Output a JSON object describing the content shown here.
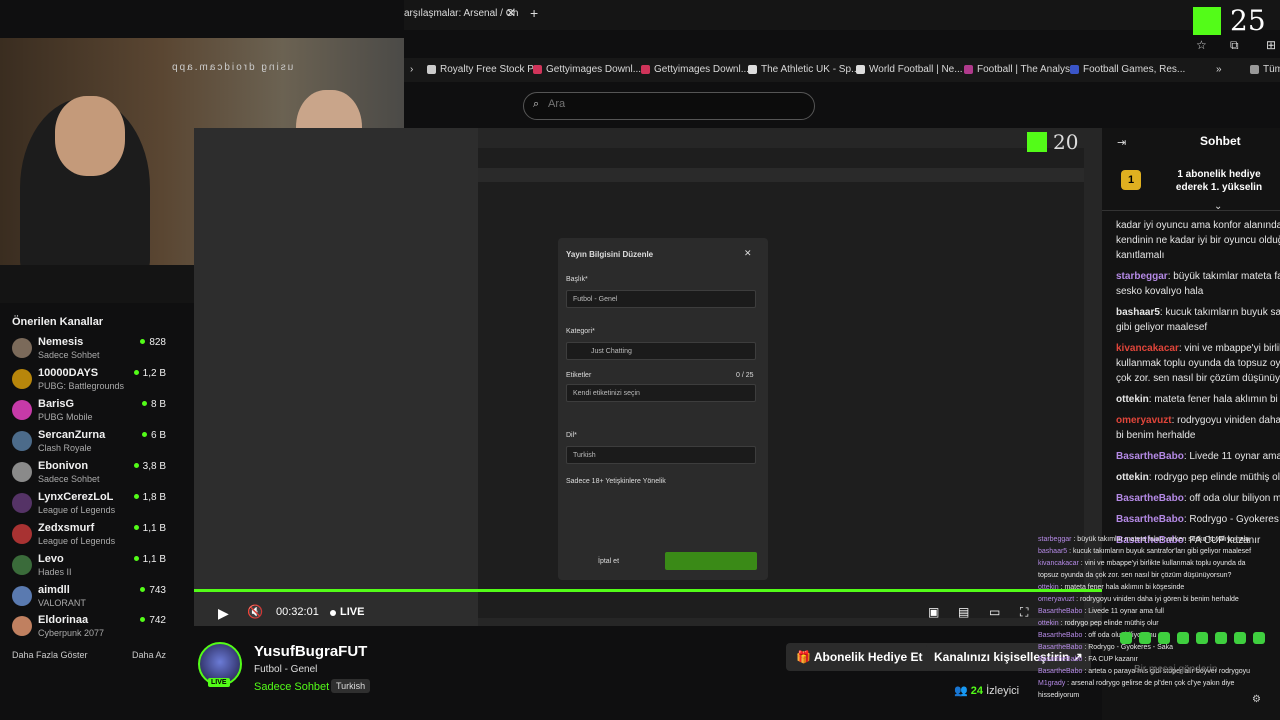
{
  "browser": {
    "tab_title": "arşılaşmalar: Arsenal / Ch",
    "tab_close": "✕",
    "new_tab": "+",
    "bookmarks": [
      {
        "label": "Royalty Free Stock P...",
        "color": "#cccccc"
      },
      {
        "label": "Gettyimages Downl...",
        "color": "#d0345a"
      },
      {
        "label": "Gettyimages Downl...",
        "color": "#d0345a"
      },
      {
        "label": "The Athletic UK - Sp...",
        "color": "#dddddd"
      },
      {
        "label": "World Football | Ne...",
        "color": "#dddddd"
      },
      {
        "label": "Football | The Analyst",
        "color": "#b03a8c"
      },
      {
        "label": "Football Games, Res...",
        "color": "#3a55c8"
      },
      {
        "label": "Tüm",
        "color": "#cccccc"
      }
    ],
    "kick_logo_text": "25"
  },
  "search": {
    "placeholder": "Ara"
  },
  "stream_inner": {
    "logo_text": "20",
    "modal_title": "Yayın Bilgisini Düzenle",
    "title_label": "Başlık*",
    "title_value": "Futbol - Genel",
    "category_label": "Kategori*",
    "category_value": "Just Chatting",
    "tags_label": "Etiketler",
    "tags_count": "0 / 25",
    "tags_placeholder": "Kendi etiketinizi seçin",
    "lang_label": "Dil*",
    "lang_value": "Turkish",
    "adult_label": "Sadece 18+ Yetişkinlere Yönelik",
    "cancel_label": "İptal et"
  },
  "player": {
    "time": "00:32:01",
    "live_label": "LIVE",
    "progress": 1.0
  },
  "sidebar": {
    "title": "Önerilen Kanallar",
    "channels": [
      {
        "name": "Nemesis",
        "game": "Sadece Sohbet",
        "viewers": "828",
        "avatar": "#7b6a5a"
      },
      {
        "name": "10000DAYS",
        "game": "PUBG: Battlegrounds",
        "viewers": "1,2 B",
        "avatar": "#b8860b"
      },
      {
        "name": "BarisG",
        "game": "PUBG Mobile",
        "viewers": "8 B",
        "avatar": "#c63aa8"
      },
      {
        "name": "SercanZurna",
        "game": "Clash Royale",
        "viewers": "6 B",
        "avatar": "#4c6b8a"
      },
      {
        "name": "Ebonivon",
        "game": "Sadece Sohbet",
        "viewers": "3,8 B",
        "avatar": "#8a8a8a"
      },
      {
        "name": "LynxCerezLoL",
        "game": "League of Legends",
        "viewers": "1,8 B",
        "avatar": "#553366"
      },
      {
        "name": "Zedxsmurf",
        "game": "League of Legends",
        "viewers": "1,1 B",
        "avatar": "#a83232"
      },
      {
        "name": "Levo",
        "game": "Hades II",
        "viewers": "1,1 B",
        "avatar": "#3a6b3a"
      },
      {
        "name": "aimdll",
        "game": "VALORANT",
        "viewers": "743",
        "avatar": "#5a7ab0"
      },
      {
        "name": "Eldorinaa",
        "game": "Cyberpunk 2077",
        "viewers": "742",
        "avatar": "#c08060"
      }
    ],
    "show_more": "Daha Fazla Göster",
    "show_less": "Daha Az"
  },
  "streamer": {
    "name": "YusufBugraFUT",
    "title": "Futbol - Genel",
    "category": "Sadece Sohbet",
    "tag": "Turkish",
    "live_badge": "LIVE",
    "gift_button": "Abonelik Hediye Et",
    "customize_button": "Kanalınızı kişiselleştirin",
    "viewer_count": "24",
    "viewer_label": "İzleyici"
  },
  "chat": {
    "header": "Sohbet",
    "pinned_text": "1 abonelik hediye ederek 1. yükselin",
    "messages": [
      {
        "user": "",
        "color": "#e6e6e6",
        "text": "kadar iyi oyuncu ama konfor alanından"
      },
      {
        "user": "",
        "color": "#e6e6e6",
        "text": "kendinin ne kadar iyi bir oyuncu olduğ"
      },
      {
        "user": "",
        "color": "#e6e6e6",
        "text": "kanıtlamalı"
      },
      {
        "user": "starbeggar",
        "color": "#b58ae6",
        "text": ": büyük takımlar mateta fala"
      },
      {
        "user": "",
        "color": "#e6e6e6",
        "text": "sesko kovalıyo hala"
      },
      {
        "user": "bashaar5",
        "color": "#e6e6e6",
        "text": ": kucuk takımların buyuk san"
      },
      {
        "user": "",
        "color": "#e6e6e6",
        "text": "gibi geliyor maalesef"
      },
      {
        "user": "kivancakacar",
        "color": "#e0453a",
        "text": ": vini ve mbappe'yi birlik"
      },
      {
        "user": "",
        "color": "#e6e6e6",
        "text": "kullanmak toplu oyunda da topsuz oyu"
      },
      {
        "user": "",
        "color": "#e6e6e6",
        "text": "çok zor. sen nasıl bir çözüm düşünüyor"
      },
      {
        "user": "ottekin",
        "color": "#e6e6e6",
        "text": ": mateta fener hala aklımın bi kö"
      },
      {
        "user": "omeryavuzt",
        "color": "#e0453a",
        "text": ": rodrygoyu viniden daha i"
      },
      {
        "user": "",
        "color": "#e6e6e6",
        "text": "bi benim herhalde"
      },
      {
        "user": "BasartheBabo",
        "color": "#b58ae6",
        "text": ": Livede 11 oynar ama fu"
      },
      {
        "user": "ottekin",
        "color": "#e6e6e6",
        "text": ": rodrygo pep elinde müthiş olu"
      },
      {
        "user": "BasartheBabo",
        "color": "#b58ae6",
        "text": ": off oda olur biliyon mu"
      },
      {
        "user": "BasartheBabo",
        "color": "#b58ae6",
        "text": ": Rodrygo - Gyokeres - "
      },
      {
        "user": "BasartheBabo",
        "color": "#b58ae6",
        "text": ": FA CUP kazanır"
      }
    ],
    "overlay": [
      {
        "user": "starbeggar",
        "text": " : büyük takımlar mateta falan varken sesko kovalıyo hala"
      },
      {
        "user": "bashaar5",
        "text": " : kucuk takımların buyuk santrafor'ları gibi geliyor maalesef"
      },
      {
        "user": "kivancakacar",
        "text": " : vini ve mbappe'yi birlikte kullanmak toplu oyunda da"
      },
      {
        "user": "",
        "text": "topsuz oyunda da çok zor. sen nasıl bir çözüm düşünüyorsun?"
      },
      {
        "user": "ottekin",
        "text": " : mateta fener hala aklımın bi köşesinde"
      },
      {
        "user": "omeryavuzt",
        "text": " : rodrygoyu viniden daha iyi gören bi benim herhalde"
      },
      {
        "user": "BasartheBabo",
        "text": " : Livede 11 oynar ama full"
      },
      {
        "user": "ottekin",
        "text": " : rodrygo pep elinde müthiş olur"
      },
      {
        "user": "BasartheBabo",
        "text": " : off oda olur biliyon mu"
      },
      {
        "user": "BasartheBabo",
        "text": " : Rodrygo - Gyokeres - Saka"
      },
      {
        "user": "BasartheBabo",
        "text": " : FA CUP kazanır"
      },
      {
        "user": "BasartheBabo",
        "text": " : arteta o paraya mis gibi stoper alır boyver rodrygoyu"
      },
      {
        "user": "M1grady",
        "text": " : arsenal rodrygo gelirse de pl'den çok cl'ye yakın diye"
      },
      {
        "user": "",
        "text": "hissediyorum"
      }
    ],
    "input_placeholder": "Bir mesaj gönderin"
  }
}
